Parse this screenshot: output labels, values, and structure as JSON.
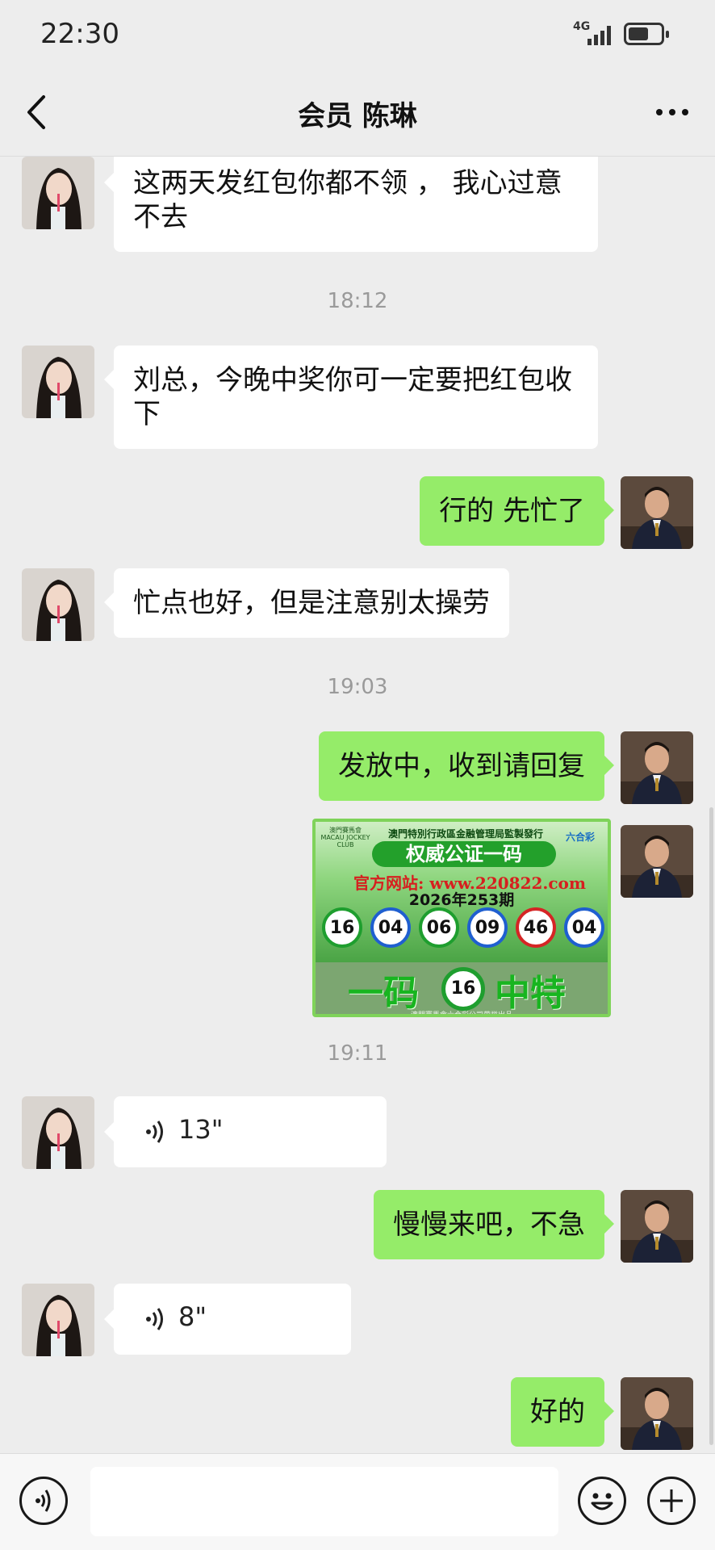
{
  "status_bar": {
    "time": "22:30",
    "network": "4G"
  },
  "header": {
    "title": "会员 陈琳"
  },
  "messages": [
    {
      "side": "in",
      "text": "这两天发红包你都不领 ， 我心过意不去"
    },
    {
      "time": "18:12"
    },
    {
      "side": "in",
      "text": "刘总，今晚中奖你可一定要把红包收下"
    },
    {
      "side": "out",
      "text": "行的 先忙了"
    },
    {
      "side": "in",
      "text": "忙点也好，但是注意别太操劳"
    },
    {
      "time": "19:03"
    },
    {
      "side": "out",
      "text": "发放中，收到请回复"
    },
    {
      "side": "out",
      "type": "image"
    },
    {
      "time": "19:11"
    },
    {
      "side": "in",
      "type": "voice",
      "duration": "13\""
    },
    {
      "side": "out",
      "text": "慢慢来吧，不急"
    },
    {
      "side": "in",
      "type": "voice",
      "duration": "8\""
    },
    {
      "side": "out",
      "text": "好的"
    }
  ],
  "lottery_image": {
    "header": "澳門特別行政區金融管理局監製發行",
    "logo_left": "澳門賽馬會 MACAU JOCKEY CLUB",
    "logo_right": "六合彩",
    "title": "权威公证一码",
    "url": "官方网站: www.220822.com",
    "issue": "2026年253期",
    "balls": [
      {
        "num": "16",
        "color": "green"
      },
      {
        "num": "04",
        "color": "blue"
      },
      {
        "num": "06",
        "color": "green"
      },
      {
        "num": "09",
        "color": "blue"
      },
      {
        "num": "46",
        "color": "red"
      },
      {
        "num": "04",
        "color": "blue"
      }
    ],
    "big_left": "一码",
    "special": "16",
    "big_right": "中特",
    "footer": "澳門賽馬會六合彩公司荣誉出品"
  },
  "colors": {
    "incoming_bubble": "#ffffff",
    "outgoing_bubble": "#95ec69",
    "background": "#ededed"
  }
}
